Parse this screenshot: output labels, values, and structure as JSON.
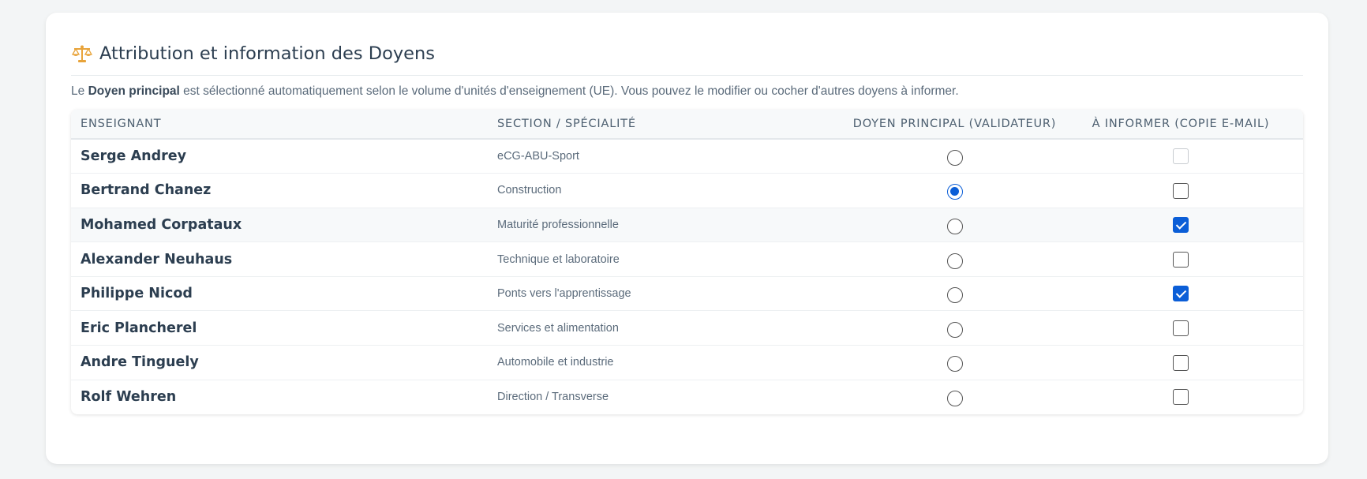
{
  "header": {
    "icon": "balance-scale-icon",
    "title": "Attribution et information des Doyens"
  },
  "intro": {
    "prefix": "Le ",
    "bold": "Doyen principal",
    "suffix": " est sélectionné automatiquement selon le volume d'unités d'enseignement (UE). Vous pouvez le modifier ou cocher d'autres doyens à informer."
  },
  "table": {
    "columns": [
      "Enseignant",
      "Section / Spécialité",
      "Doyen principal (validateur)",
      "À informer (copie e-mail)"
    ],
    "rows": [
      {
        "name": "Serge Andrey",
        "section": "eCG-ABU-Sport",
        "principal": false,
        "inform": false,
        "inform_disabled": true
      },
      {
        "name": "Bertrand Chanez",
        "section": "Construction",
        "principal": true,
        "inform": false,
        "inform_disabled": false
      },
      {
        "name": "Mohamed Corpataux",
        "section": "Maturité professionnelle",
        "principal": false,
        "inform": true,
        "inform_disabled": false
      },
      {
        "name": "Alexander Neuhaus",
        "section": "Technique et laboratoire",
        "principal": false,
        "inform": false,
        "inform_disabled": false
      },
      {
        "name": "Philippe Nicod",
        "section": "Ponts vers l'apprentissage",
        "principal": false,
        "inform": true,
        "inform_disabled": false
      },
      {
        "name": "Eric Plancherel",
        "section": "Services et alimentation",
        "principal": false,
        "inform": false,
        "inform_disabled": false
      },
      {
        "name": "Andre Tinguely",
        "section": "Automobile et industrie",
        "principal": false,
        "inform": false,
        "inform_disabled": false
      },
      {
        "name": "Rolf Wehren",
        "section": "Direction / Transverse",
        "principal": false,
        "inform": false,
        "inform_disabled": false
      }
    ]
  },
  "colors": {
    "accent": "#0b5ed7",
    "icon": "#e8a33a"
  }
}
